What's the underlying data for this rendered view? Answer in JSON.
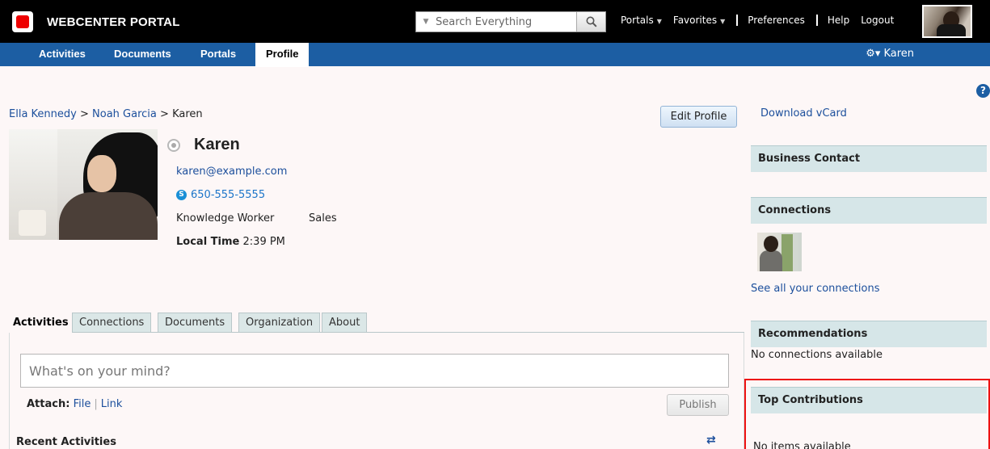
{
  "header": {
    "brand": "WEBCENTER PORTAL",
    "search_placeholder": "Search Everything",
    "links": {
      "portals": "Portals",
      "favorites": "Favorites",
      "preferences": "Preferences",
      "help": "Help",
      "logout": "Logout"
    }
  },
  "nav": {
    "tabs": [
      "Activities",
      "Documents",
      "Portals",
      "Profile"
    ],
    "active": "Profile",
    "user": "Karen"
  },
  "breadcrumb": {
    "items": [
      "Ella Kennedy",
      "Noah Garcia",
      "Karen"
    ],
    "separator": ">"
  },
  "profile": {
    "edit_label": "Edit Profile",
    "name": "Karen",
    "email": "karen@example.com",
    "phone": "650-555-5555",
    "title": "Knowledge Worker",
    "department": "Sales",
    "local_time_label": "Local Time",
    "local_time": "2:39 PM"
  },
  "tabs": {
    "items": [
      "Activities",
      "Connections",
      "Documents",
      "Organization",
      "About"
    ],
    "active": "Activities"
  },
  "activity": {
    "placeholder": "What's on your mind?",
    "attach_label": "Attach:",
    "file_link": "File",
    "link_link": "Link",
    "publish_label": "Publish",
    "recent_title": "Recent Activities"
  },
  "sidebar": {
    "vcard": "Download vCard",
    "business_contact": "Business Contact",
    "connections": "Connections",
    "see_all": "See all your connections",
    "recommendations": "Recommendations",
    "no_connections": "No connections available",
    "top_contributions": "Top Contributions",
    "no_items": "No items available"
  },
  "colors": {
    "nav_blue": "#1c5ea3",
    "section_header": "#d6e6e8",
    "highlight_border": "#e11111"
  }
}
